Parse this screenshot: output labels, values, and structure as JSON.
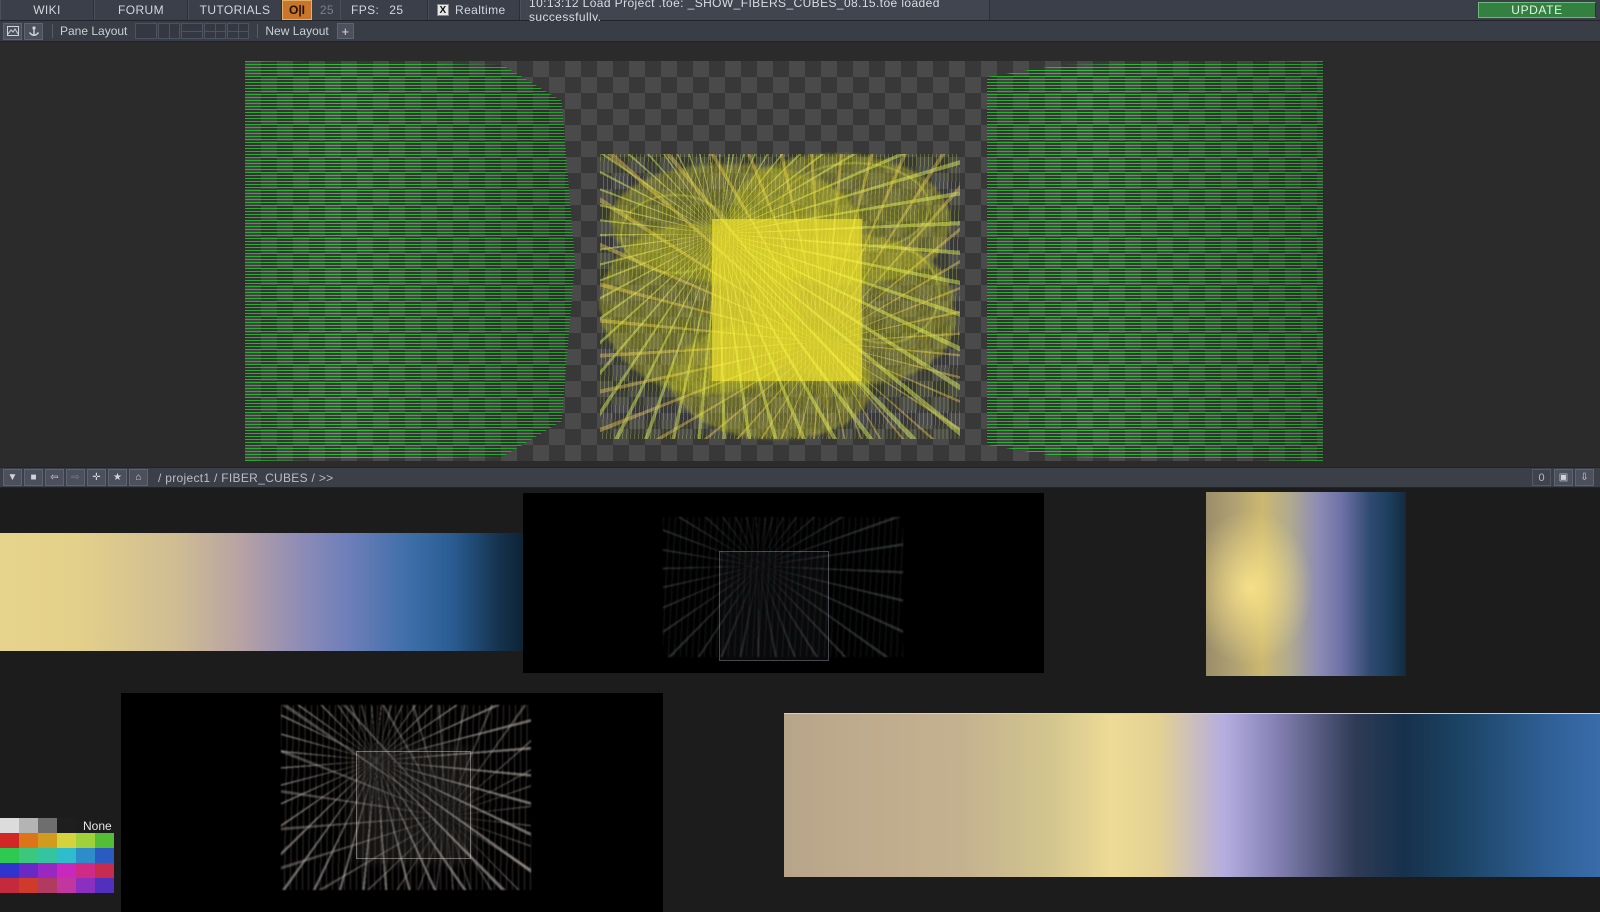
{
  "topbar": {
    "wiki": "WIKI",
    "forum": "FORUM",
    "tutorials": "TUTORIALS",
    "oi_label": "O|I",
    "frame": "25",
    "fps_label": "FPS:",
    "fps_value": "25",
    "realtime_check": "X",
    "realtime_label": "Realtime",
    "status": "10:13:12 Load Project .toe: _SHOW_FIBERS_CUBES_08.15.toe loaded successfully.",
    "update_label": "UPDATE",
    "accent_orange": "#c9762a",
    "accent_green": "#338040"
  },
  "layoutbar": {
    "icon_window": "window-icon",
    "icon_anchor": "anchor-icon",
    "pane_layout_label": "Pane Layout",
    "presets": [
      "single-pane",
      "two-vertical",
      "two-horizontal",
      "three-pane",
      "grid-four"
    ],
    "new_layout_label": "New Layout",
    "new_layout_plus": "+"
  },
  "pane_top": {
    "buttons": [
      "dropdown-arrow",
      "stop-square",
      "back-arrow",
      "forward-arrow",
      "plus",
      "star",
      "home"
    ],
    "path": "/ >>",
    "zoom_value": "0",
    "fit_icon": "fit-window-icon",
    "down_icon": "down-arrow-icon"
  },
  "pane_bottom": {
    "buttons": [
      "dropdown-arrow",
      "stop-square",
      "back-arrow",
      "forward-arrow",
      "plus",
      "star",
      "home"
    ],
    "path": "/ project1 / FIBER_CUBES / >>",
    "zoom_value": "0",
    "fit_icon": "fit-window-icon",
    "down_icon": "down-arrow-icon"
  },
  "viewport": {
    "name": "3d-render-viewport",
    "fiber_color": "#2ac834",
    "cube_color": "#e2d62c",
    "checker_light": "#4a4a4a",
    "checker_dark": "#383838"
  },
  "nodes": [
    {
      "name": "gradient-node-wide-top",
      "kind": "gradient-horizontal"
    },
    {
      "name": "render-node-dark-top",
      "kind": "render-black"
    },
    {
      "name": "gradient-node-vertical",
      "kind": "gradient-vertical"
    },
    {
      "name": "render-node-dark-bottom",
      "kind": "render-black"
    },
    {
      "name": "gradient-node-wide-bottom",
      "kind": "gradient-horizontal"
    }
  ],
  "palette": {
    "none_label": "None",
    "row_head": [
      "#dcdcdc",
      "#b4b4b4",
      "#6e6e6e",
      "#1e1e1e"
    ],
    "rows": [
      [
        "#d32626",
        "#dd7518",
        "#d19b1d",
        "#d4d33c",
        "#9ed13a",
        "#52bd35"
      ],
      [
        "#2fc850",
        "#3cc77e",
        "#34c4a0",
        "#2fbccc",
        "#2d8cc9",
        "#2a5bc0"
      ],
      [
        "#3232cc",
        "#6a28c4",
        "#9a27c2",
        "#c928bd",
        "#cf2a86",
        "#c82b50"
      ],
      [
        "#c42a3c",
        "#cf3a2a",
        "#b03a60",
        "#c236a0",
        "#8b2fc0",
        "#5030bd"
      ]
    ]
  }
}
